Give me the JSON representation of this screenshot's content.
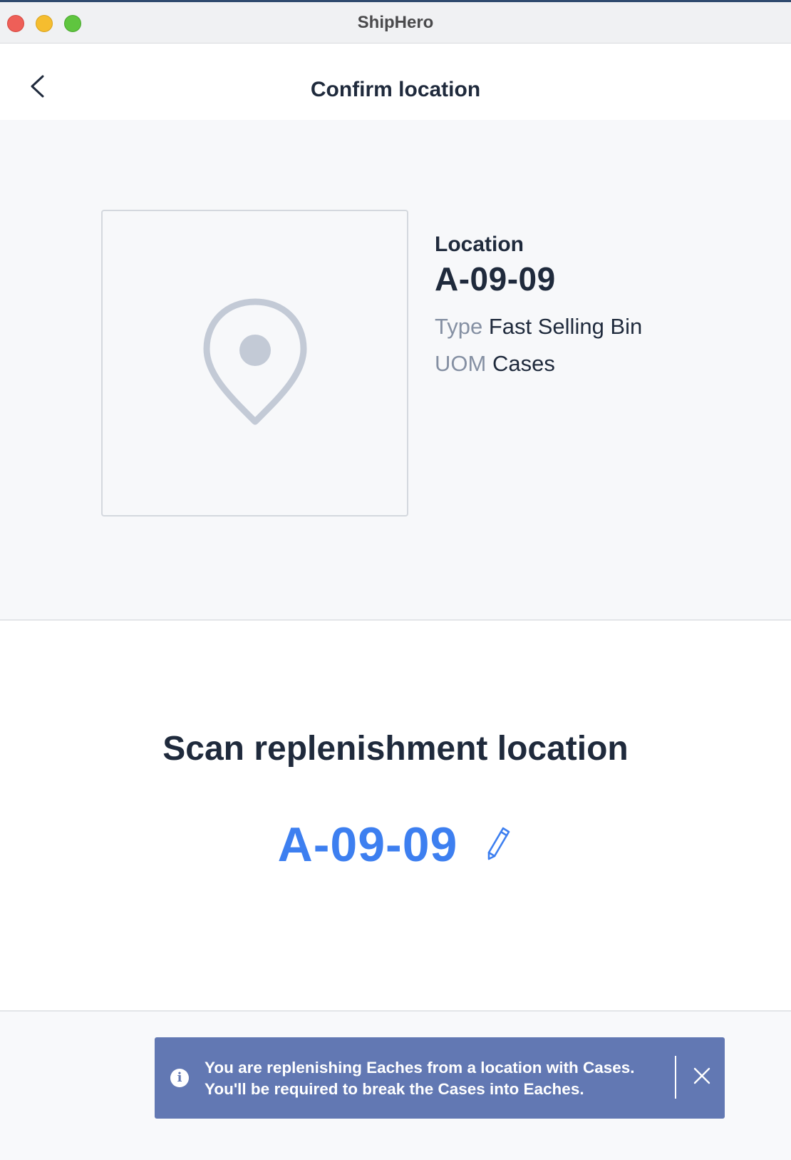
{
  "window": {
    "app_title": "ShipHero"
  },
  "header": {
    "title": "Confirm location",
    "back_icon": "chevron-left-icon"
  },
  "location": {
    "image_icon": "map-pin-icon",
    "label": "Location",
    "code": "A-09-09",
    "type_label": "Type",
    "type_value": "Fast Selling Bin",
    "uom_label": "UOM",
    "uom_value": "Cases"
  },
  "scan": {
    "title": "Scan replenishment location",
    "value": "A-09-09",
    "edit_icon": "pencil-icon"
  },
  "toast": {
    "icon": "info-icon",
    "line1": "You are replenishing Eaches from a location with Cases.",
    "line2": "You'll be required to break the Cases into Eaches.",
    "close_icon": "close-icon"
  },
  "colors": {
    "accent": "#3d7ff0",
    "toast_bg": "#6278b3",
    "text_dark": "#1f2a3c",
    "text_muted": "#8590a3"
  }
}
